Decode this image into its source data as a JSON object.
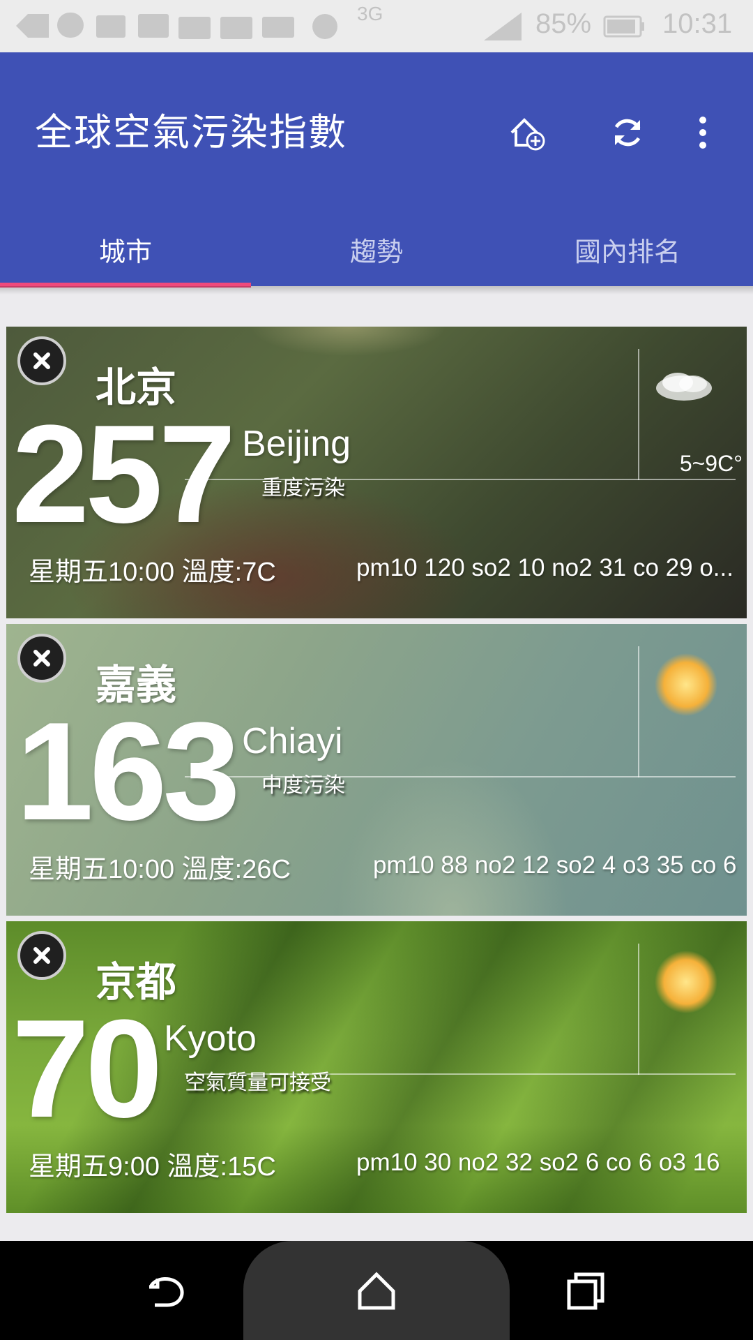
{
  "status_bar": {
    "network": "3G",
    "battery_percent": "85%",
    "time": "10:31"
  },
  "app": {
    "title": "全球空氣污染指數",
    "actions": [
      "add-city-icon",
      "refresh-icon",
      "more-vert-icon"
    ],
    "colors": {
      "primary": "#3f51b5",
      "indicator": "#ef4a7c"
    }
  },
  "tabs": [
    {
      "label": "城市",
      "active": true
    },
    {
      "label": "趨勢",
      "active": false
    },
    {
      "label": "國內排名",
      "active": false
    }
  ],
  "cards": [
    {
      "city_cn": "北京",
      "aqi": "257",
      "city_en": "Beijing",
      "level": "重度污染",
      "date_temp": "星期五10:00 溫度:7C",
      "pollutants": "pm10 120 so2 10 no2 31 co 29 o...",
      "weather": "cloud-icon",
      "temp_range": "5~9C°"
    },
    {
      "city_cn": "嘉義",
      "aqi": "163",
      "city_en": "Chiayi",
      "level": "中度污染",
      "date_temp": "星期五10:00 溫度:26C",
      "pollutants": "pm10 88 no2 12 so2 4 o3 35 co 6",
      "weather": "sun-icon"
    },
    {
      "city_cn": "京都",
      "aqi": "70",
      "city_en": "Kyoto",
      "level": "空氣質量可接受",
      "date_temp": "星期五9:00 溫度:15C",
      "pollutants": "pm10 30 no2 32 so2 6 co 6 o3 16",
      "weather": "sun-icon"
    }
  ],
  "nav_bar": [
    "back-icon",
    "home-icon",
    "recents-icon"
  ]
}
